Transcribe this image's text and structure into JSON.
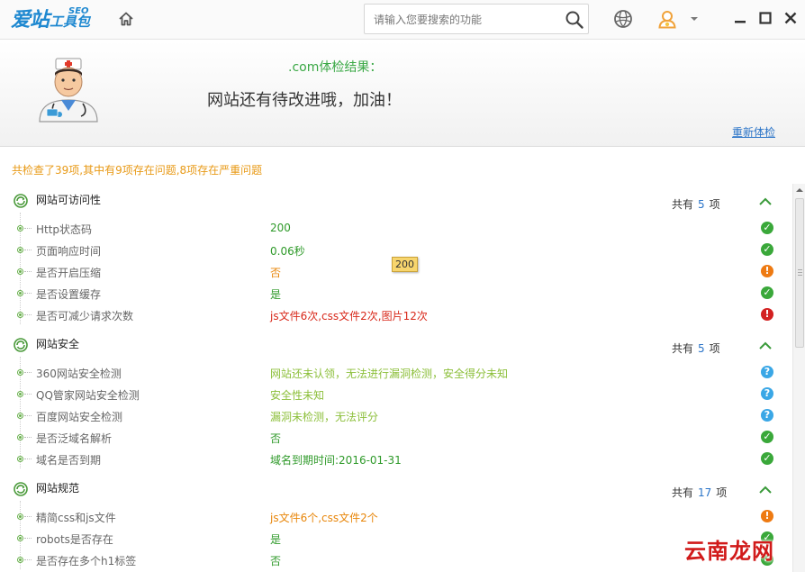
{
  "app": {
    "logo_main": "爱站",
    "logo_seo": "SEO",
    "logo_tool": "工具包",
    "search_placeholder": "请输入您要搜索的功能"
  },
  "header": {
    "result_title": ".com体检结果：",
    "result_message": "网站还有待改进哦，加油！",
    "recheck_label": "重新体检"
  },
  "summary": "共检查了39项,其中有9项存在问题,8项存在严重问题",
  "tooltip": "200",
  "sections": [
    {
      "title": "网站可访问性",
      "count_prefix": "共有",
      "count": "5",
      "count_suffix": "项",
      "items": [
        {
          "label": "Http状态码",
          "value": "200",
          "value_color": "green",
          "status": "ok"
        },
        {
          "label": "页面响应时间",
          "value": "0.06秒",
          "value_color": "green",
          "status": "ok"
        },
        {
          "label": "是否开启压缩",
          "value": "否",
          "value_color": "orange",
          "status": "warn"
        },
        {
          "label": "是否设置缓存",
          "value": "是",
          "value_color": "green",
          "status": "ok"
        },
        {
          "label": "是否可减少请求次数",
          "value": "js文件6次,css文件2次,图片12次",
          "value_color": "red",
          "status": "error"
        }
      ]
    },
    {
      "title": "网站安全",
      "count_prefix": "共有",
      "count": "5",
      "count_suffix": "项",
      "items": [
        {
          "label": "360网站安全检测",
          "value": "网站还未认领，无法进行漏洞检测，安全得分未知",
          "value_color": "lightgreen",
          "status": "unknown"
        },
        {
          "label": "QQ管家网站安全检测",
          "value": "安全性未知",
          "value_color": "lightgreen",
          "status": "unknown"
        },
        {
          "label": "百度网站安全检测",
          "value": "漏洞未检测，无法评分",
          "value_color": "lightgreen",
          "status": "unknown"
        },
        {
          "label": "是否泛域名解析",
          "value": "否",
          "value_color": "green",
          "status": "ok"
        },
        {
          "label": "域名是否到期",
          "value": "域名到期时间:2016-01-31",
          "value_color": "green",
          "status": "ok"
        }
      ]
    },
    {
      "title": "网站规范",
      "count_prefix": "共有",
      "count": "17",
      "count_suffix": "项",
      "items": [
        {
          "label": "精简css和js文件",
          "value": "js文件6个,css文件2个",
          "value_color": "orange",
          "status": "warn"
        },
        {
          "label": "robots是否存在",
          "value": "是",
          "value_color": "green",
          "status": "ok"
        },
        {
          "label": "是否存在多个h1标签",
          "value": "否",
          "value_color": "green",
          "status": "ok"
        }
      ]
    }
  ],
  "status_glyphs": {
    "ok": "✓",
    "warn": "!",
    "error": "!",
    "unknown": "?"
  },
  "watermark": "云南龙网"
}
